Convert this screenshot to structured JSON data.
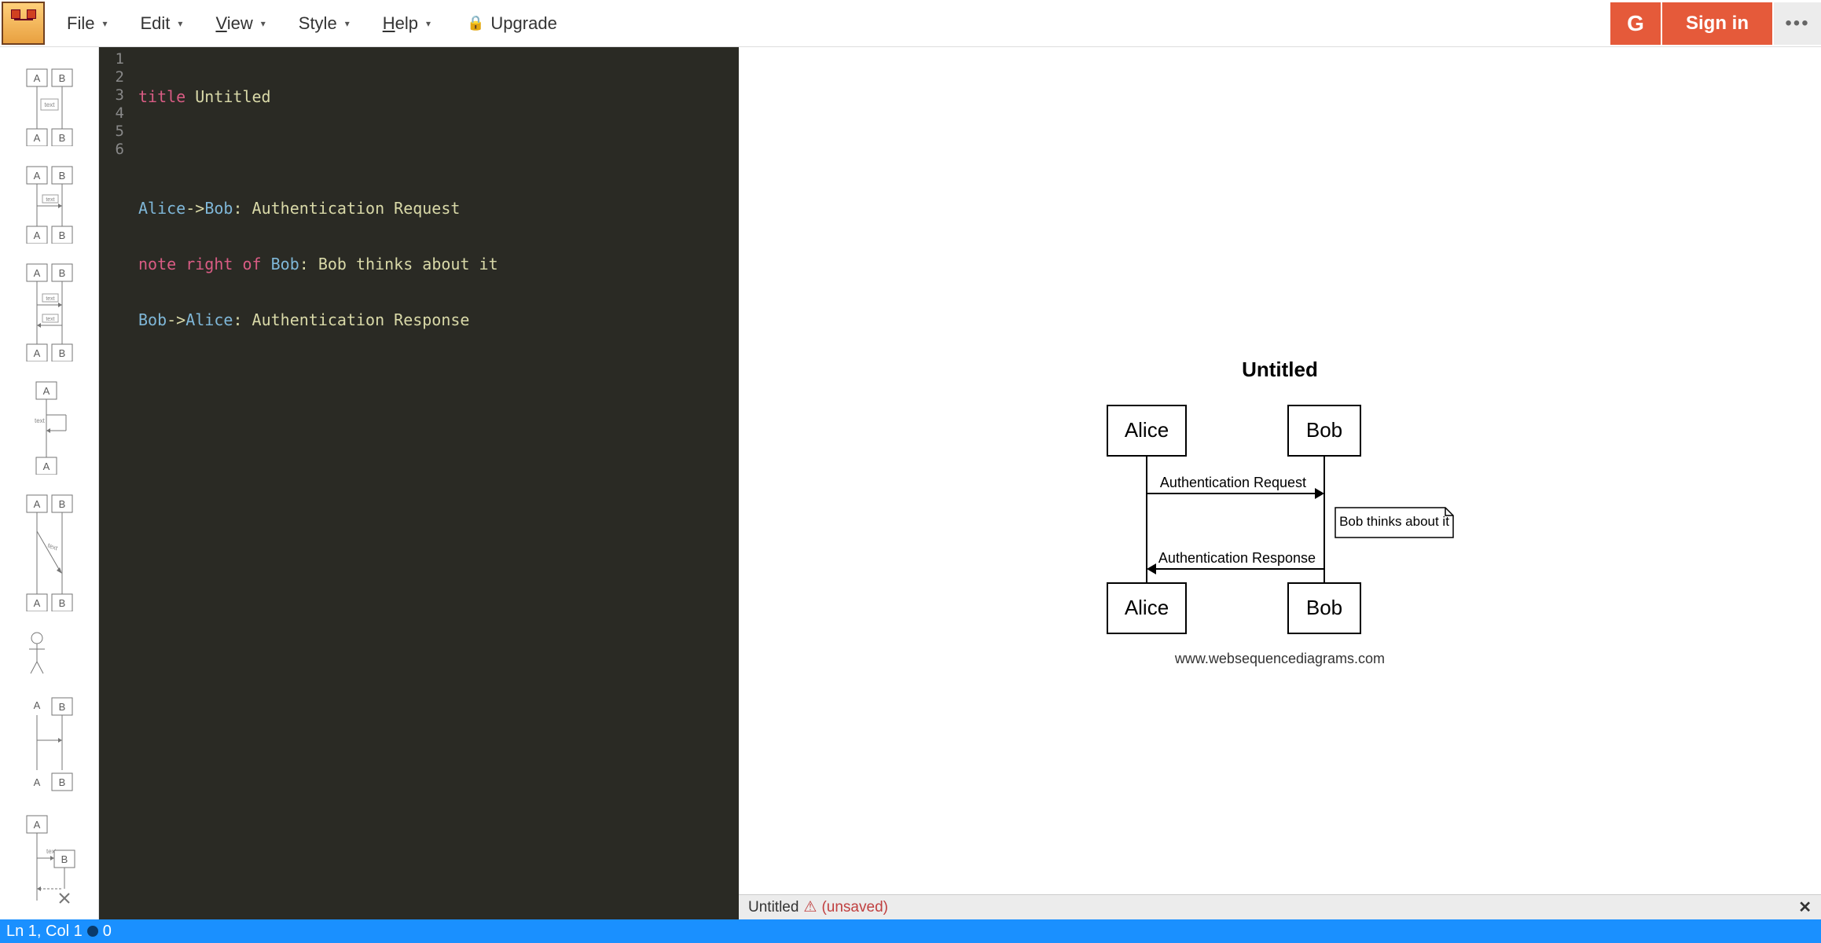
{
  "menu": {
    "file": "File",
    "edit": "Edit",
    "view": "View",
    "style": "Style",
    "help": "Help",
    "upgrade": "Upgrade"
  },
  "auth": {
    "google_g": "G",
    "signin": "Sign in",
    "more": "•••"
  },
  "editor": {
    "lines": {
      "l1": {
        "kw": "title",
        "rest": " Untitled"
      },
      "l2": {
        "blank": ""
      },
      "l3": {
        "a": "Alice",
        "arrow": "->",
        "b": "Bob",
        "colon": ": ",
        "msg": "Authentication Request"
      },
      "l4": {
        "kw1": "note",
        "kw2": "right",
        "kw3": "of",
        "b": "Bob",
        "colon": ": ",
        "msg": "Bob thinks about it"
      },
      "l5": {
        "a": "Bob",
        "arrow": "->",
        "b": "Alice",
        "colon": ": ",
        "msg": "Authentication Response"
      },
      "l6": {
        "blank": ""
      }
    },
    "gutter": [
      "1",
      "2",
      "3",
      "4",
      "5",
      "6"
    ]
  },
  "diagram": {
    "title": "Untitled",
    "actor_a": "Alice",
    "actor_b": "Bob",
    "msg1": "Authentication Request",
    "note": "Bob thinks about it",
    "msg2": "Authentication Response",
    "footer": "www.websequencediagrams.com"
  },
  "preview_status": {
    "title": "Untitled",
    "unsaved": "(unsaved)"
  },
  "statusbar": {
    "pos": "Ln 1, Col 1",
    "errors": "0"
  },
  "sidebar": {
    "thumbs": [
      "A",
      "B",
      "text"
    ]
  }
}
